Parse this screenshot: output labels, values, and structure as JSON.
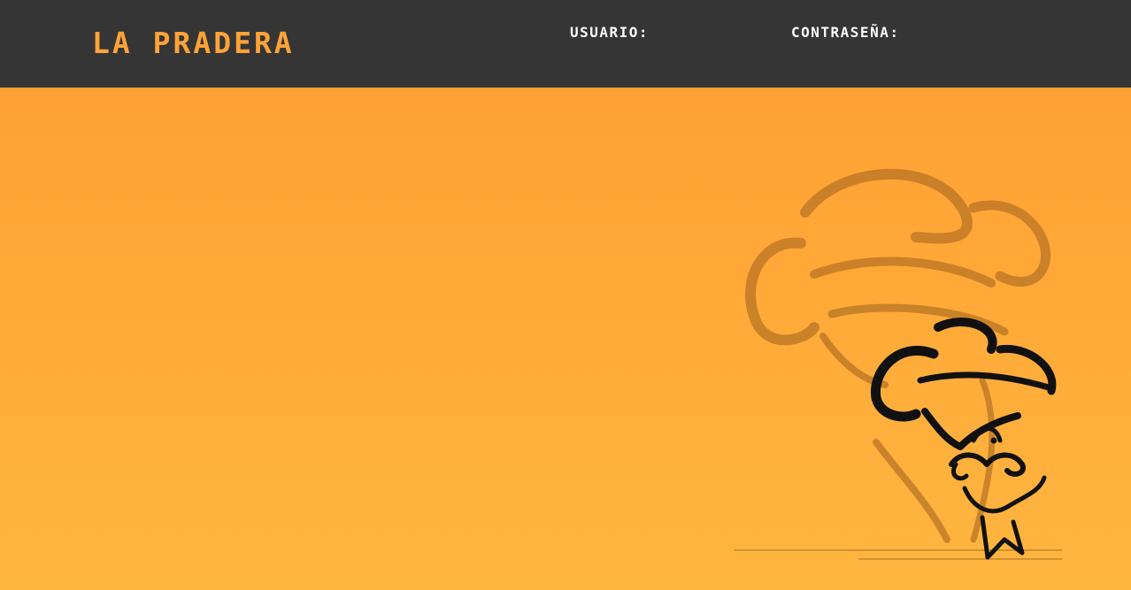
{
  "header": {
    "brand": "La Pradera",
    "username_label": "Usuario:",
    "password_label": "Contraseña:"
  },
  "colors": {
    "header_bg": "#353535",
    "brand": "#ffa338",
    "labels": "#ffffff",
    "background_top": "#ff9d33",
    "background_bottom": "#ffb640"
  },
  "decor": {
    "illustration": "chef-mascot-icon"
  }
}
